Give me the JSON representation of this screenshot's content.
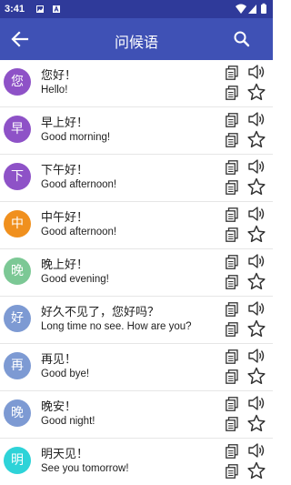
{
  "status": {
    "time": "3:41"
  },
  "appbar": {
    "title": "问候语"
  },
  "colors": {
    "primary": "#3f51b5",
    "status": "#2f3a9a",
    "purple": "#8e52c7",
    "orange": "#f0901e",
    "green": "#7cc895",
    "blue": "#7d9ad3",
    "cyan": "#2ed3d8"
  },
  "items": [
    {
      "avatar": "您",
      "color": "#8e52c7",
      "chinese": "您好！",
      "english": "Hello!"
    },
    {
      "avatar": "早",
      "color": "#8e52c7",
      "chinese": "早上好！",
      "english": "Good morning!"
    },
    {
      "avatar": "下",
      "color": "#8e52c7",
      "chinese": "下午好！",
      "english": "Good afternoon!"
    },
    {
      "avatar": "中",
      "color": "#f0901e",
      "chinese": "中午好！",
      "english": "Good afternoon!"
    },
    {
      "avatar": "晚",
      "color": "#7cc895",
      "chinese": "晚上好！",
      "english": "Good evening!"
    },
    {
      "avatar": "好",
      "color": "#7d9ad3",
      "chinese": "好久不见了，您好吗？",
      "english": "Long time no see. How are you?"
    },
    {
      "avatar": "再",
      "color": "#7d9ad3",
      "chinese": "再见！",
      "english": "Good bye!"
    },
    {
      "avatar": "晚",
      "color": "#7d9ad3",
      "chinese": "晚安！",
      "english": "Good night!"
    },
    {
      "avatar": "明",
      "color": "#2ed3d8",
      "chinese": "明天见！",
      "english": "See you tomorrow!"
    }
  ],
  "icons": [
    "back-arrow-icon",
    "search-icon",
    "copy-icon",
    "speaker-icon",
    "star-icon"
  ]
}
